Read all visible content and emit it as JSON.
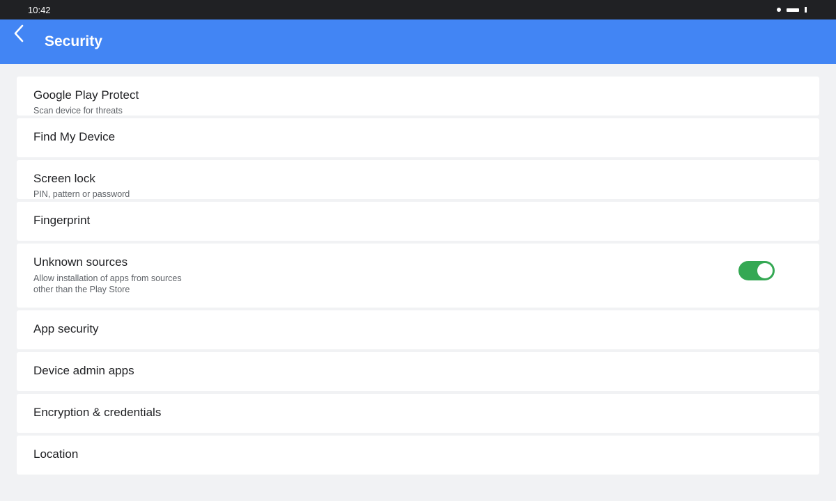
{
  "status_bar": {
    "time": "10:42",
    "icons": [
      "dot-icon",
      "wifi-icon",
      "battery-icon"
    ]
  },
  "app_bar": {
    "title": "Security",
    "back_icon": "chevron-left-icon",
    "color": "#4285f4"
  },
  "items": [
    {
      "title": "Google Play Protect",
      "subtitle": "Scan device for threats"
    },
    {
      "title": "Find My Device",
      "subtitle": ""
    },
    {
      "title": "Screen lock",
      "subtitle": "PIN, pattern or password"
    },
    {
      "title": "Fingerprint",
      "subtitle": ""
    },
    {
      "title": "Unknown sources",
      "subtitle": "Allow installation of apps from sources\nother than the Play Store",
      "toggle": true,
      "toggle_color": "#34a853"
    },
    {
      "title": "App security",
      "subtitle": ""
    },
    {
      "title": "Device admin apps",
      "subtitle": ""
    },
    {
      "title": "Encryption & credentials",
      "subtitle": ""
    },
    {
      "title": "Location",
      "subtitle": ""
    }
  ]
}
